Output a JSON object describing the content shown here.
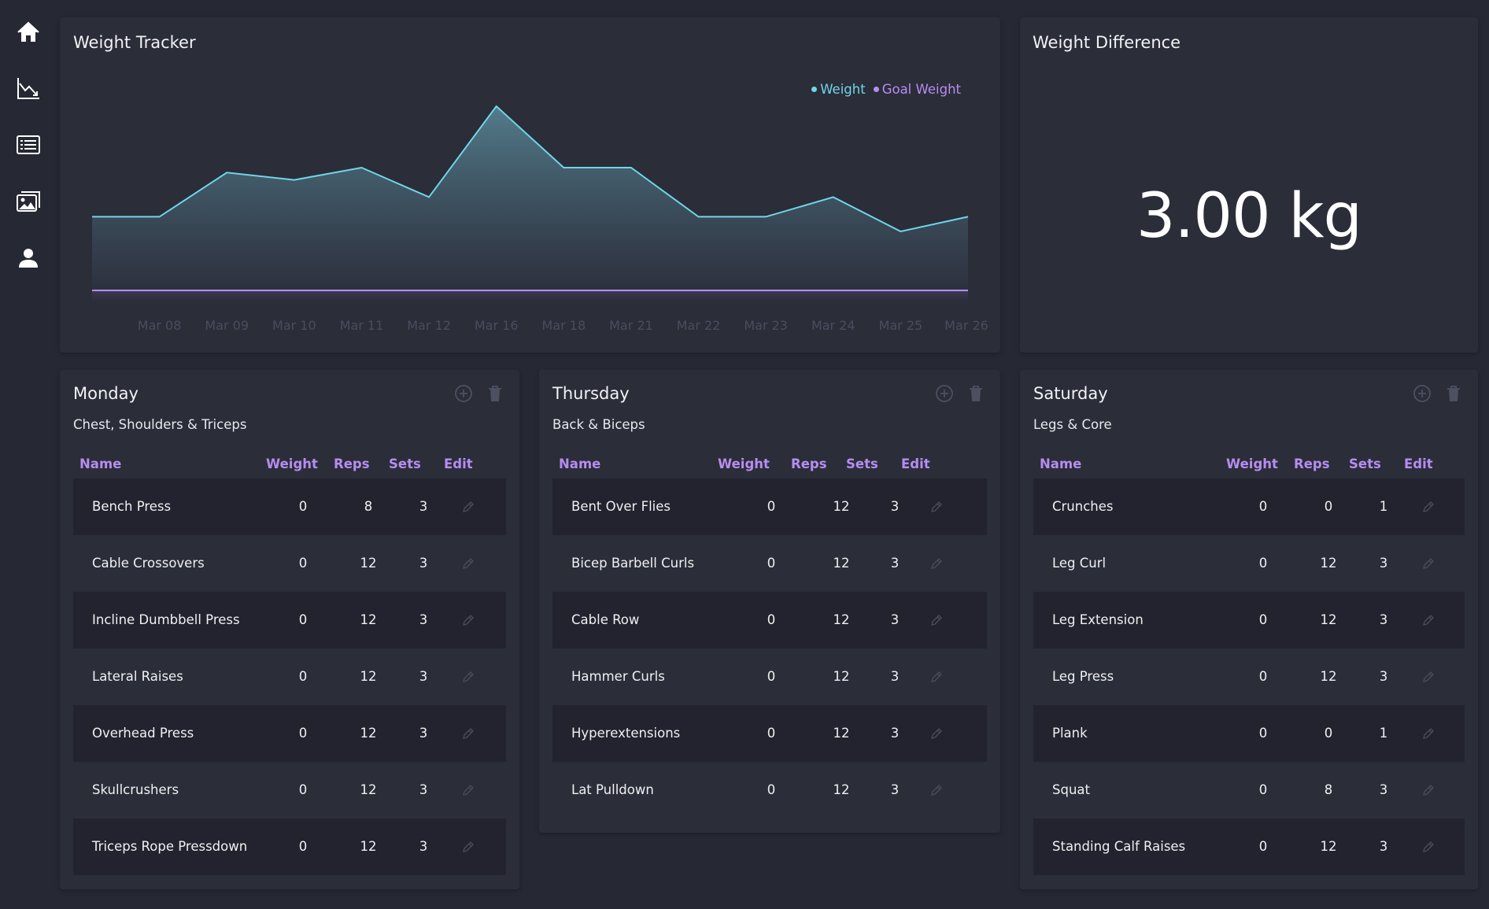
{
  "sidebar": {
    "items": [
      {
        "icon": "home-icon"
      },
      {
        "icon": "chart-line-icon"
      },
      {
        "icon": "list-icon"
      },
      {
        "icon": "gallery-icon"
      },
      {
        "icon": "user-icon"
      }
    ]
  },
  "weight_tracker": {
    "title": "Weight Tracker",
    "legend": [
      {
        "label": "Weight",
        "color": "#6fd6e8"
      },
      {
        "label": "Goal Weight",
        "color": "#b68df0"
      }
    ]
  },
  "chart_data": {
    "type": "area",
    "title": "Weight Tracker",
    "categories": [
      "",
      "Mar 08",
      "Mar 09",
      "Mar 10",
      "Mar 11",
      "Mar 12",
      "Mar 16",
      "Mar 18",
      "Mar 21",
      "Mar 22",
      "Mar 23",
      "Mar 24",
      "Mar 25",
      "Mar 26"
    ],
    "series": [
      {
        "name": "Weight",
        "color": "#6fd6e8",
        "values": [
          3.0,
          3.0,
          4.8,
          4.5,
          5.0,
          3.8,
          7.5,
          5.0,
          5.0,
          3.0,
          3.0,
          3.8,
          2.4,
          3.0
        ]
      },
      {
        "name": "Goal Weight",
        "color": "#b68df0",
        "values": [
          0,
          0,
          0,
          0,
          0,
          0,
          0,
          0,
          0,
          0,
          0,
          0,
          0,
          0
        ]
      }
    ],
    "grid": false,
    "legend": "top-right"
  },
  "weight_difference": {
    "title": "Weight Difference",
    "value": "3.00 kg"
  },
  "table_headers": {
    "name": "Name",
    "weight": "Weight",
    "reps": "Reps",
    "sets": "Sets",
    "edit": "Edit"
  },
  "days": [
    {
      "title": "Monday",
      "subtitle": "Chest, Shoulders & Triceps",
      "exercises": [
        {
          "name": "Bench Press",
          "weight": "0",
          "reps": "8",
          "sets": "3"
        },
        {
          "name": "Cable Crossovers",
          "weight": "0",
          "reps": "12",
          "sets": "3"
        },
        {
          "name": "Incline Dumbbell Press",
          "weight": "0",
          "reps": "12",
          "sets": "3"
        },
        {
          "name": "Lateral Raises",
          "weight": "0",
          "reps": "12",
          "sets": "3"
        },
        {
          "name": "Overhead Press",
          "weight": "0",
          "reps": "12",
          "sets": "3"
        },
        {
          "name": "Skullcrushers",
          "weight": "0",
          "reps": "12",
          "sets": "3"
        },
        {
          "name": "Triceps Rope Pressdown",
          "weight": "0",
          "reps": "12",
          "sets": "3"
        }
      ]
    },
    {
      "title": "Thursday",
      "subtitle": "Back & Biceps",
      "exercises": [
        {
          "name": "Bent Over Flies",
          "weight": "0",
          "reps": "12",
          "sets": "3"
        },
        {
          "name": "Bicep Barbell Curls",
          "weight": "0",
          "reps": "12",
          "sets": "3"
        },
        {
          "name": "Cable Row",
          "weight": "0",
          "reps": "12",
          "sets": "3"
        },
        {
          "name": "Hammer Curls",
          "weight": "0",
          "reps": "12",
          "sets": "3"
        },
        {
          "name": "Hyperextensions",
          "weight": "0",
          "reps": "12",
          "sets": "3"
        },
        {
          "name": "Lat Pulldown",
          "weight": "0",
          "reps": "12",
          "sets": "3"
        }
      ]
    },
    {
      "title": "Saturday",
      "subtitle": "Legs & Core",
      "exercises": [
        {
          "name": "Crunches",
          "weight": "0",
          "reps": "0",
          "sets": "1"
        },
        {
          "name": "Leg Curl",
          "weight": "0",
          "reps": "12",
          "sets": "3"
        },
        {
          "name": "Leg Extension",
          "weight": "0",
          "reps": "12",
          "sets": "3"
        },
        {
          "name": "Leg Press",
          "weight": "0",
          "reps": "12",
          "sets": "3"
        },
        {
          "name": "Plank",
          "weight": "0",
          "reps": "0",
          "sets": "1"
        },
        {
          "name": "Squat",
          "weight": "0",
          "reps": "8",
          "sets": "3"
        },
        {
          "name": "Standing Calf Raises",
          "weight": "0",
          "reps": "12",
          "sets": "3"
        }
      ]
    }
  ]
}
